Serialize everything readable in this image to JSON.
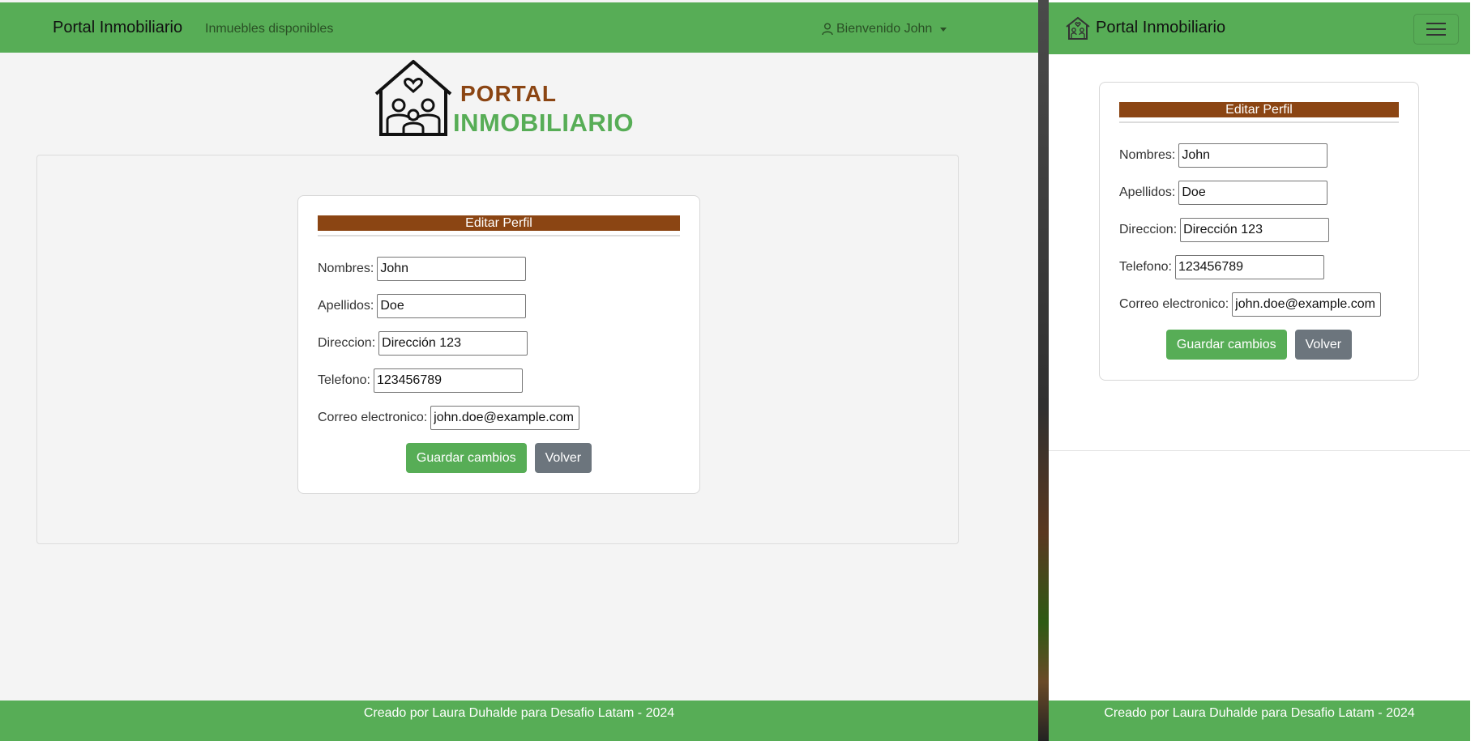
{
  "desktop": {
    "navbar": {
      "brand": "Portal Inmobiliario",
      "link": "Inmuebles disponibles",
      "user_menu": "Bienvenido John"
    },
    "logo": {
      "line1": "PORTAL",
      "line2": "INMOBILIARIO"
    },
    "form": {
      "title": "Editar Perfil",
      "fields": [
        {
          "label": "Nombres:",
          "value": "John"
        },
        {
          "label": "Apellidos:",
          "value": "Doe"
        },
        {
          "label": "Direccion:",
          "value": "Dirección 123"
        },
        {
          "label": "Telefono:",
          "value": "123456789"
        },
        {
          "label": "Correo electronico:",
          "value": "john.doe@example.com"
        }
      ],
      "save_label": "Guardar cambios",
      "back_label": "Volver"
    },
    "footer": "Creado por Laura Duhalde para Desafio Latam - 2024"
  },
  "mobile": {
    "navbar": {
      "brand": "Portal Inmobiliario"
    },
    "form": {
      "title": "Editar Perfil",
      "fields": [
        {
          "label": "Nombres:",
          "value": "John"
        },
        {
          "label": "Apellidos:",
          "value": "Doe"
        },
        {
          "label": "Direccion:",
          "value": "Dirección 123"
        },
        {
          "label": "Telefono:",
          "value": "123456789"
        },
        {
          "label": "Correo electronico:",
          "value": "john.doe@example.com"
        }
      ],
      "save_label": "Guardar cambios",
      "back_label": "Volver"
    },
    "footer": "Creado por Laura Duhalde para Desafio Latam - 2024"
  },
  "colors": {
    "navbar_green": "#57ad56",
    "title_brown": "#8b4513",
    "button_gray": "#6c757d",
    "page_background": "#f4f4f4"
  },
  "icons": [
    "user-icon",
    "caret-down-icon",
    "house-family-logo",
    "house-icon",
    "hamburger-menu-icon"
  ]
}
